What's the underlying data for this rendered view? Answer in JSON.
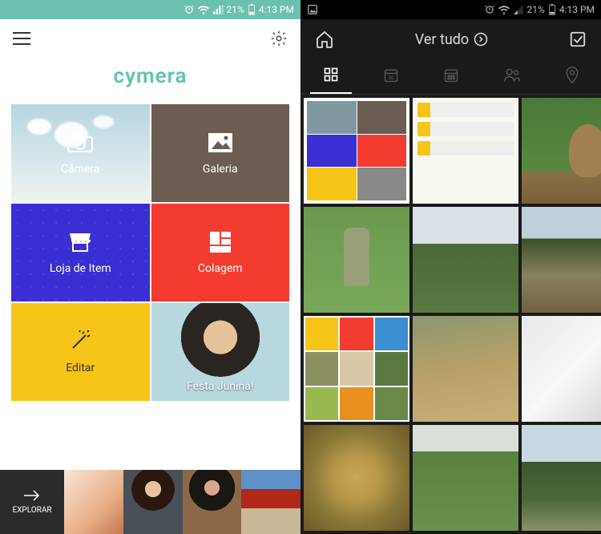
{
  "statusbar": {
    "battery": "21%",
    "time": "4:13 PM"
  },
  "left": {
    "logo": "cymera",
    "tiles": {
      "camera": "Câmera",
      "gallery": "Galeria",
      "store": "Loja de Item",
      "collage": "Colagem",
      "edit": "Editar",
      "festa": "Festa Junina!"
    },
    "explorar": "EXPLORAR"
  },
  "right": {
    "title": "Ver tudo",
    "cal_badge": "30"
  }
}
